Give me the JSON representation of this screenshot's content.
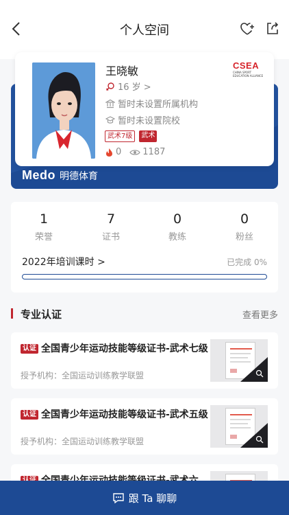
{
  "nav": {
    "title": "个人空间"
  },
  "profile": {
    "name": "王晓敏",
    "age": "16 岁 >",
    "institution": "暂时未设置所属机构",
    "school": "暂时未设置院校",
    "tags": [
      "武术7级",
      "武术"
    ],
    "likes": "0",
    "views": "1187",
    "org_logo": {
      "big": "CSEA",
      "small_1": "CHINA  SPORT",
      "small_2": "EDUCATION  ALLIANCE"
    },
    "brand_en": "Medo",
    "brand_cn": "明德体育"
  },
  "stats": [
    {
      "value": "1",
      "label": "荣誉"
    },
    {
      "value": "7",
      "label": "证书"
    },
    {
      "value": "0",
      "label": "教练"
    },
    {
      "value": "0",
      "label": "粉丝"
    }
  ],
  "training": {
    "label": "2022年培训课时 >",
    "status": "已完成 0%",
    "progress": 0
  },
  "section": {
    "title": "专业认证",
    "more": "查看更多"
  },
  "certs": [
    {
      "badge": "认证",
      "title": "全国青少年运动技能等级证书-武术七级",
      "org": "授予机构：全国运动训练教学联盟"
    },
    {
      "badge": "认证",
      "title": "全国青少年运动技能等级证书-武术五级",
      "org": "授予机构：全国运动训练教学联盟"
    },
    {
      "badge": "认证",
      "title": "全国青少年运动技能等级证书-武术六",
      "org": ""
    }
  ],
  "footer": {
    "label": "跟 Ta 聊聊"
  },
  "colors": {
    "brand_blue": "#1d4a94",
    "accent_red": "#c0262f"
  }
}
